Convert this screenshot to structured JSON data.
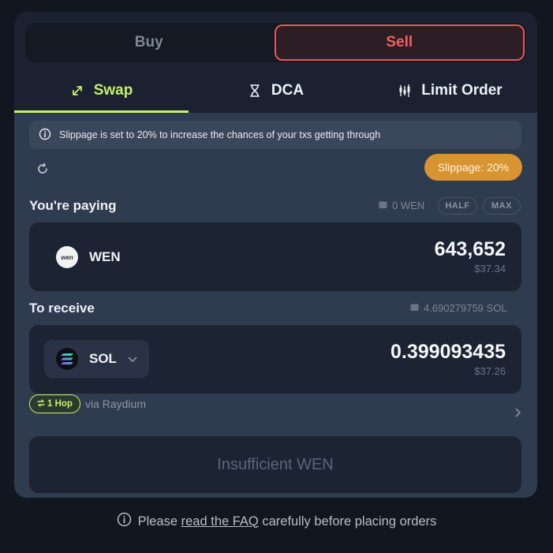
{
  "mode": {
    "buy_label": "Buy",
    "sell_label": "Sell",
    "active": "Sell"
  },
  "tabs": [
    {
      "label": "Swap",
      "icon": "swap-arrows-icon",
      "active": true
    },
    {
      "label": "DCA",
      "icon": "hourglass-icon",
      "active": false
    },
    {
      "label": "Limit Order",
      "icon": "candlestick-icon",
      "active": false
    }
  ],
  "notice": {
    "text": "Slippage is set to 20% to increase the chances of your txs getting through",
    "icon": "info-icon"
  },
  "slippage": {
    "label": "Slippage: 20%"
  },
  "paying": {
    "label": "You're paying",
    "balance": "0 WEN",
    "half_label": "HALF",
    "max_label": "MAX",
    "token": "WEN",
    "token_logo_text": "wen",
    "amount": "643,652",
    "usd": "$37.34"
  },
  "receive": {
    "label": "To receive",
    "balance": "4.690279759 SOL",
    "token": "SOL",
    "amount": "0.399093435",
    "usd": "$37.26"
  },
  "route": {
    "hop_label": "1 Hop",
    "via": "via Raydium"
  },
  "cta": {
    "label": "Insufficient WEN"
  },
  "footer": {
    "prefix": "Please",
    "link": "read the FAQ",
    "suffix": "carefully before placing orders"
  },
  "colors": {
    "accent": "#c5f06a",
    "sell": "#f06062",
    "slippage": "#d79431",
    "panel": "#1b2130",
    "body": "#2f3b4e"
  }
}
